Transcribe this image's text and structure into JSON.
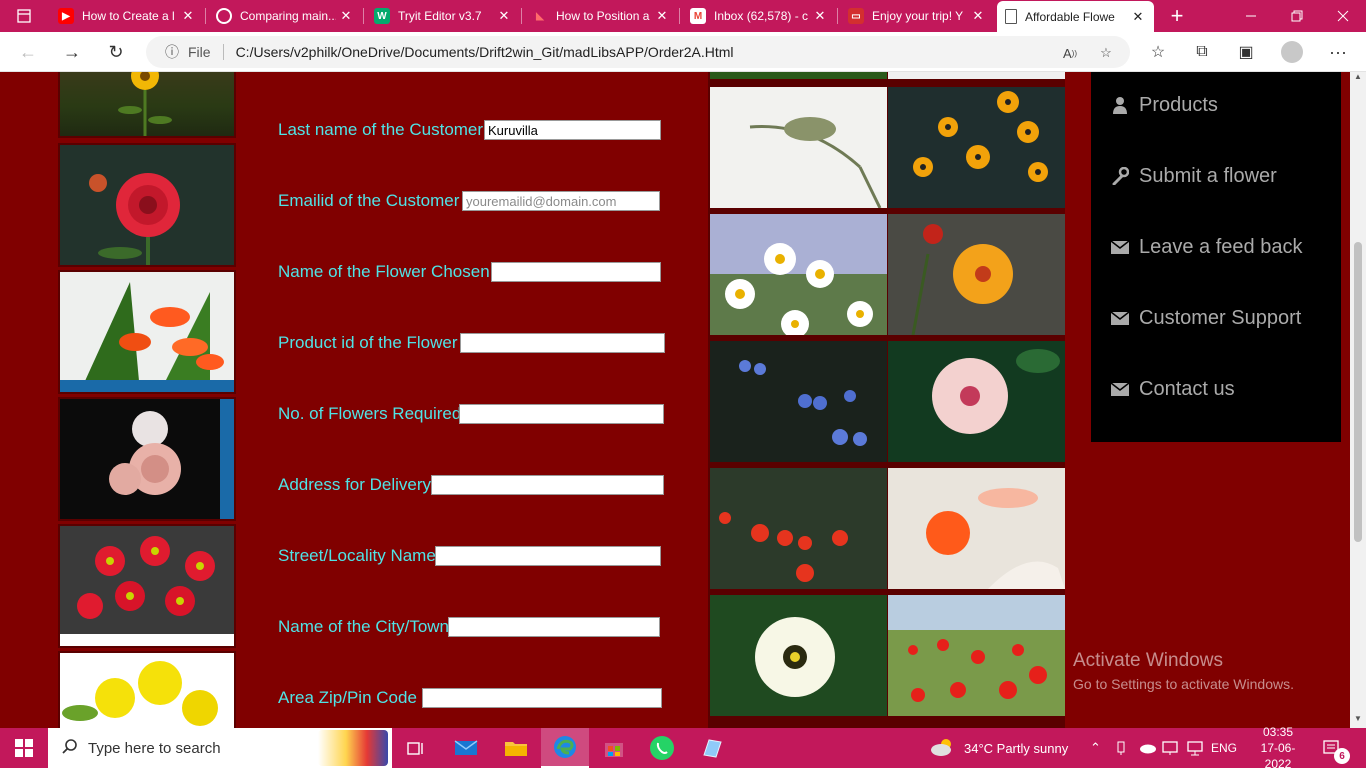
{
  "browser": {
    "tabs": [
      {
        "title": "How to Create a l",
        "icon": "youtube-icon",
        "color": "#ff0000",
        "active": false
      },
      {
        "title": "Comparing main...",
        "icon": "github-icon",
        "color": "#ffffff",
        "active": false
      },
      {
        "title": "Tryit Editor v3.7",
        "icon": "w3schools-icon",
        "color": "#04aa6d",
        "active": false
      },
      {
        "title": "How to Position a",
        "icon": "bookmark-icon",
        "color": "#e33",
        "active": false
      },
      {
        "title": "Inbox (62,578) - c",
        "icon": "gmail-icon",
        "color": "#ea4335",
        "active": false
      },
      {
        "title": "Enjoy your trip! Y",
        "icon": "bus-icon",
        "color": "#d32f2f",
        "active": false
      },
      {
        "title": "Affordable Flowe",
        "icon": "page-icon",
        "color": "#555555",
        "active": true
      }
    ],
    "new_tab": "+",
    "file_label": "File",
    "url": "C:/Users/v2philk/OneDrive/Documents/Drift2win_Git/madLibsAPP/Order2A.Html"
  },
  "form": {
    "fields": [
      {
        "label": "Last name of the Customer :",
        "value": "Kuruvilla",
        "placeholder": ""
      },
      {
        "label": "Emailid of the Customer :",
        "value": "",
        "placeholder": "youremailid@domain.com"
      },
      {
        "label": "Name of the Flower Chosen :",
        "value": "",
        "placeholder": ""
      },
      {
        "label": "Product id of the Flower :",
        "value": "",
        "placeholder": ""
      },
      {
        "label": "No. of Flowers Required:",
        "value": "",
        "placeholder": ""
      },
      {
        "label": "Address for Delivery:",
        "value": "",
        "placeholder": ""
      },
      {
        "label": "Street/Locality Name:",
        "value": "",
        "placeholder": ""
      },
      {
        "label": "Name of the City/Town:",
        "value": "",
        "placeholder": ""
      },
      {
        "label": "Area Zip/Pin Code :",
        "value": "",
        "placeholder": ""
      }
    ]
  },
  "menu": {
    "items": [
      {
        "label": "Products",
        "icon": "user-icon"
      },
      {
        "label": "Submit a flower",
        "icon": "wrench-icon"
      },
      {
        "label": "Leave a feed back",
        "icon": "envelope-icon"
      },
      {
        "label": "Customer Support",
        "icon": "envelope-icon"
      },
      {
        "label": "Contact us",
        "icon": "envelope-icon"
      }
    ]
  },
  "watermark": {
    "title": "Activate Windows",
    "subtitle": "Go to Settings to activate Windows."
  },
  "taskbar": {
    "search_placeholder": "Type here to search",
    "weather": "34°C  Partly sunny",
    "language": "ENG",
    "time": "03:35",
    "date": "17-06-2022",
    "notifications": "6"
  },
  "colors": {
    "accent": "#c2185b",
    "page_bg": "#800000",
    "label": "#4fe3e6",
    "menu_bg": "#000000"
  }
}
